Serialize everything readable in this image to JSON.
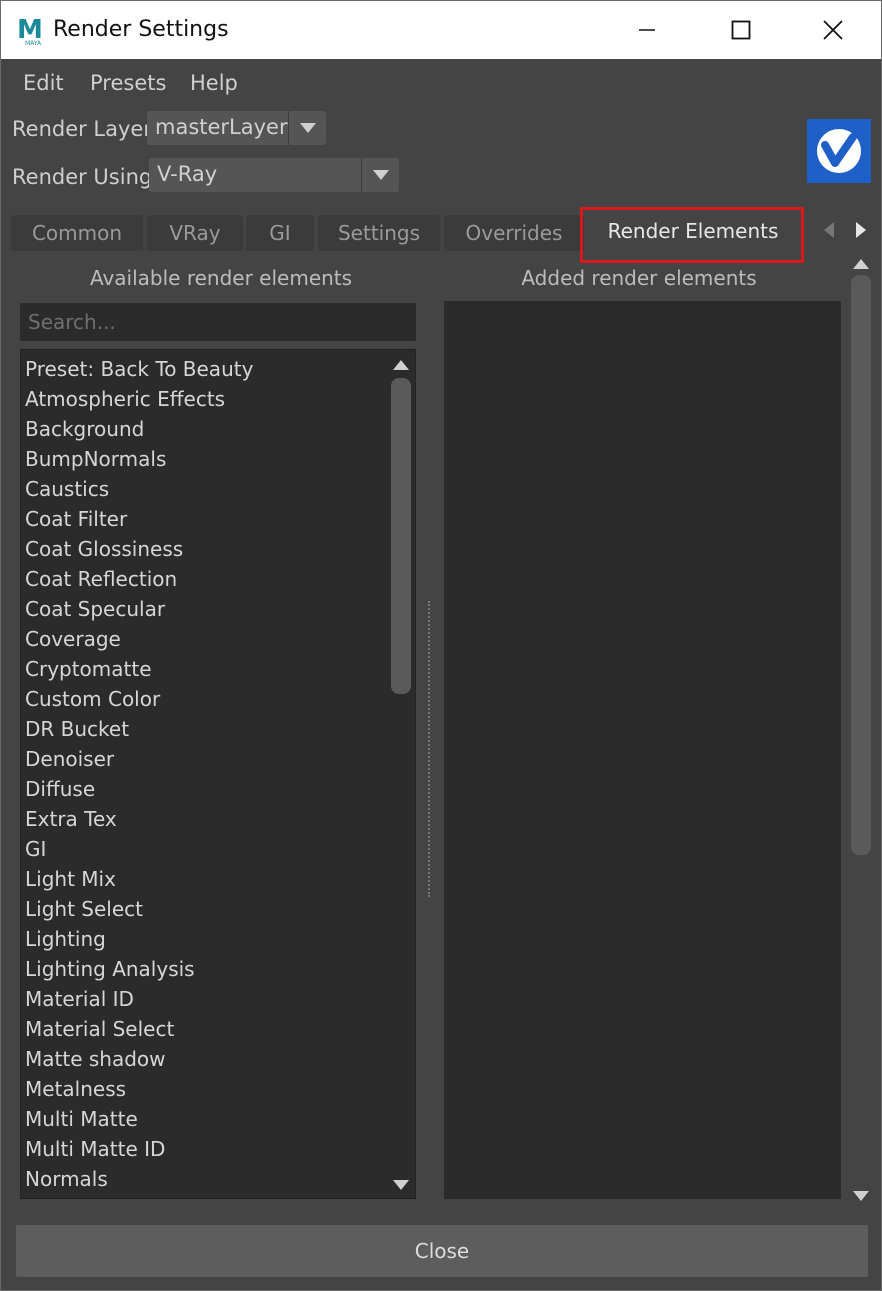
{
  "window": {
    "title": "Render Settings",
    "app_icon_letter": "M",
    "app_icon_sub": "MAYA"
  },
  "menu": {
    "items": [
      "Edit",
      "Presets",
      "Help"
    ]
  },
  "render_layer": {
    "label": "Render Layer",
    "value": "masterLayer"
  },
  "render_using": {
    "label": "Render Using",
    "value": "V-Ray"
  },
  "tabs": [
    {
      "label": "Common",
      "active": false
    },
    {
      "label": "VRay",
      "active": false
    },
    {
      "label": "GI",
      "active": false
    },
    {
      "label": "Settings",
      "active": false
    },
    {
      "label": "Overrides",
      "active": false
    },
    {
      "label": "Render Elements",
      "active": true
    }
  ],
  "available": {
    "title": "Available render elements",
    "search_placeholder": "Search...",
    "items": [
      "Preset: Back To Beauty",
      "Atmospheric Effects",
      "Background",
      "BumpNormals",
      "Caustics",
      "Coat Filter",
      "Coat Glossiness",
      "Coat Reflection",
      "Coat Specular",
      "Coverage",
      "Cryptomatte",
      "Custom Color",
      "DR Bucket",
      "Denoiser",
      "Diffuse",
      "Extra Tex",
      "GI",
      "Light Mix",
      "Light Select",
      "Lighting",
      "Lighting Analysis",
      "Material ID",
      "Material Select",
      "Matte shadow",
      "Metalness",
      "Multi Matte",
      "Multi Matte ID",
      "Normals"
    ]
  },
  "added": {
    "title": "Added render elements"
  },
  "footer": {
    "close_label": "Close"
  },
  "colors": {
    "background": "#444444",
    "list_bg": "#2b2b2b",
    "highlight": "#d7191c",
    "vray_blue": "#1f60c8"
  }
}
